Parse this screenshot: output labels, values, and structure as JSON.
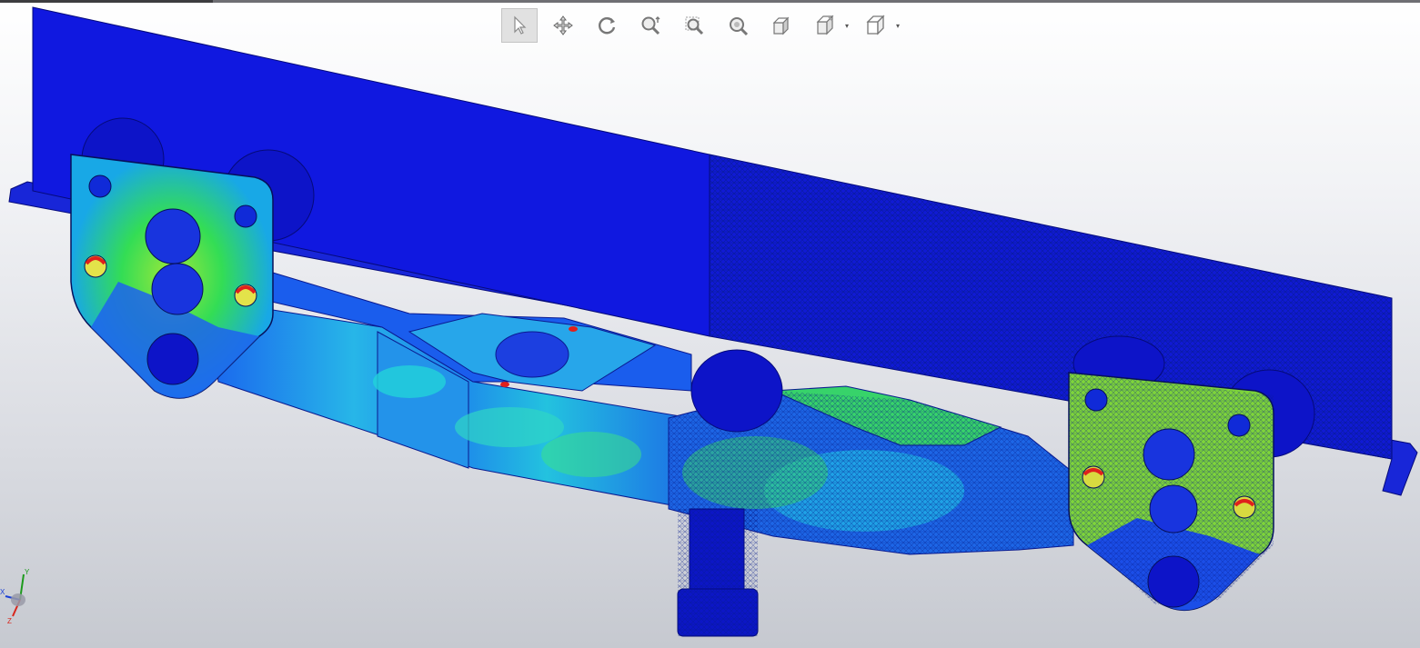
{
  "window": {
    "title": ""
  },
  "toolbar": {
    "tools": [
      {
        "name": "select",
        "icon": "cursor-icon",
        "active": true
      },
      {
        "name": "pan",
        "icon": "pan-icon",
        "active": false
      },
      {
        "name": "rotate",
        "icon": "rotate-icon",
        "active": false
      },
      {
        "name": "zoom",
        "icon": "zoom-icon",
        "active": false
      },
      {
        "name": "zoom-window",
        "icon": "zoom-window-icon",
        "active": false
      },
      {
        "name": "zoom-fit",
        "icon": "zoom-fit-icon",
        "active": false
      },
      {
        "name": "view-orientation",
        "icon": "view-orientation-icon",
        "active": false
      },
      {
        "name": "display-style",
        "icon": "display-style-icon",
        "active": false,
        "dropdown": true
      },
      {
        "name": "view-cube",
        "icon": "cube-icon",
        "active": false,
        "dropdown": true
      }
    ]
  },
  "triad": {
    "y_label": "Y",
    "x_label": "X",
    "z_label": "Z"
  },
  "colors": {
    "blue_dark": "#0a0fd6",
    "blue_mid": "#1648e6",
    "cyan": "#22c9e6",
    "green": "#36e24a",
    "yellow": "#c9e82a",
    "red": "#e0201c"
  }
}
